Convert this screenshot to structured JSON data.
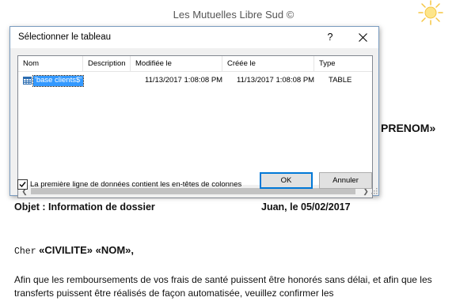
{
  "document": {
    "header": "Les Mutuelles Libre Sud ©",
    "merge_field_prenom": "PRENOM»",
    "objet": "Objet : Information de dossier",
    "lieu_date": "Juan, le 05/02/2017",
    "salutation_prefix": "Cher",
    "salutation_fields": "«CIVILITE» «NOM»,",
    "paragraph": "Afin que les remboursements de vos frais de santé puissent être honorés sans délai, et afin que les transferts puissent être réalisés de façon automatisée, veuillez confirmer les",
    "sun_icon": "sun-icon"
  },
  "dialog": {
    "title": "Sélectionner le tableau",
    "help_label": "?",
    "close_icon": "close-icon",
    "columns": {
      "name": "Nom",
      "description": "Description",
      "modified": "Modifiée le",
      "created": "Créée le",
      "type": "Type"
    },
    "rows": [
      {
        "name": "'base clients$'",
        "description": "",
        "modified": "11/13/2017 1:08:08 PM",
        "created": "11/13/2017 1:08:08 PM",
        "type": "TABLE",
        "icon": "table-icon",
        "selected": true
      }
    ],
    "first_row_headers_label": "La première ligne de données contient les en-têtes de colonnes",
    "first_row_headers_checked": true,
    "ok_label": "OK",
    "cancel_label": "Annuler",
    "colors": {
      "selection": "#3399ff",
      "default_button_border": "#0078d7"
    }
  }
}
